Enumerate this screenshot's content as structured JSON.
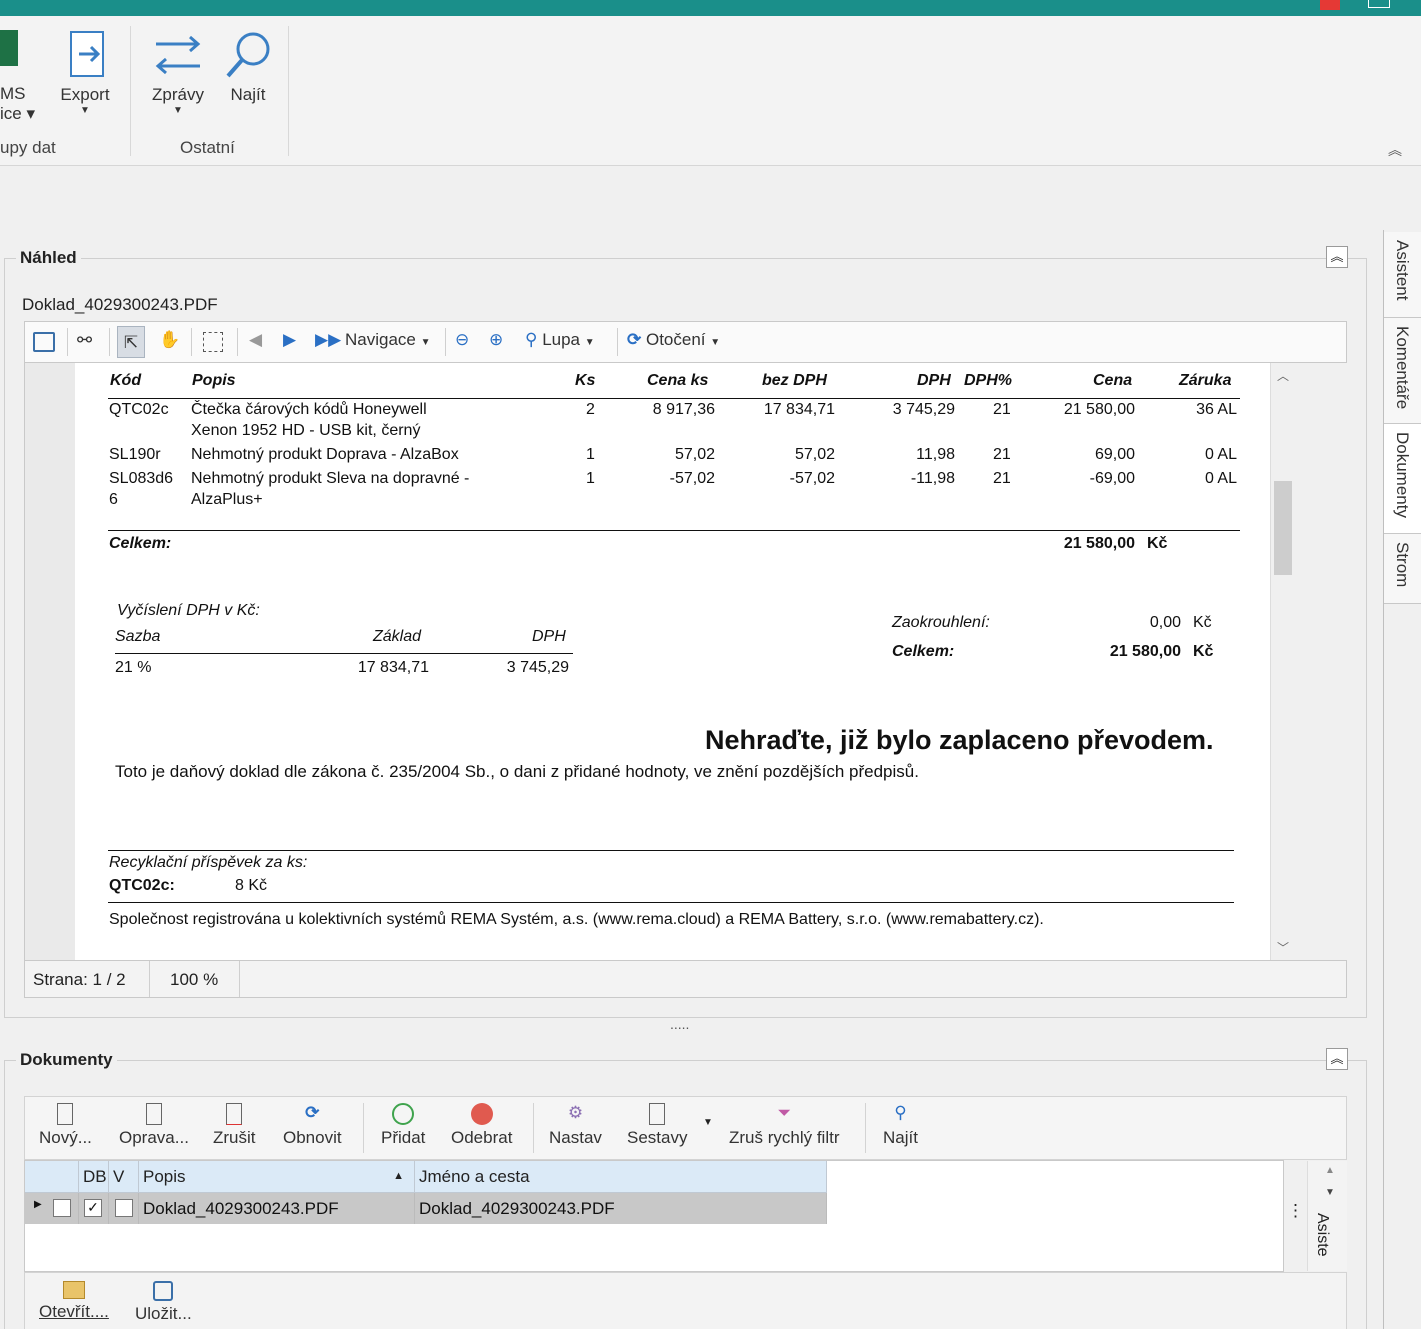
{
  "ribbon": {
    "buttons": {
      "ms_office": "MS\nOffice",
      "export": "Export",
      "zpravy": "Zprávy",
      "najit": "Najít"
    },
    "ms_partial_1": "MS",
    "ms_partial_2": "ice ▾",
    "group_data": "upy dat",
    "group_ostatni": "Ostatní"
  },
  "nahled": {
    "title": "Náhled",
    "filename": "Doklad_4029300243.PDF",
    "toolbar": {
      "navigace": "Navigace",
      "lupa": "Lupa",
      "otoceni": "Otočení"
    },
    "status": {
      "strana": "Strana: 1 / 2",
      "zoom": "100 %"
    }
  },
  "invoice": {
    "headers": [
      "Kód",
      "Popis",
      "Ks",
      "Cena ks",
      "bez DPH",
      "DPH",
      "DPH%",
      "Cena",
      "Záruka"
    ],
    "rows": [
      {
        "kod": "QTC02c",
        "popis1": "Čtečka čárových kódů Honeywell",
        "popis2": "Xenon 1952 HD - USB kit, černý",
        "ks": "2",
        "cena_ks": "8 917,36",
        "bez_dph": "17 834,71",
        "dph": "3 745,29",
        "dph_pct": "21",
        "cena": "21 580,00",
        "zaruka": "36 AL"
      },
      {
        "kod": "SL190r",
        "popis1": "Nehmotný produkt Doprava - AlzaBox",
        "popis2": "",
        "ks": "1",
        "cena_ks": "57,02",
        "bez_dph": "57,02",
        "dph": "11,98",
        "dph_pct": "21",
        "cena": "69,00",
        "zaruka": "0 AL"
      },
      {
        "kod": "SL083d6",
        "kod2": "6",
        "popis1": "Nehmotný produkt Sleva na dopravné -",
        "popis2": "AlzaPlus+",
        "ks": "1",
        "cena_ks": "-57,02",
        "bez_dph": "-57,02",
        "dph": "-11,98",
        "dph_pct": "21",
        "cena": "-69,00",
        "zaruka": "0 AL"
      }
    ],
    "celkem_label": "Celkem:",
    "celkem_value": "21 580,00",
    "currency": "Kč",
    "vat_title": "Vyčíslení DPH v Kč:",
    "vat_headers": [
      "Sazba",
      "Základ",
      "DPH"
    ],
    "vat_row": [
      "21 %",
      "17 834,71",
      "3 745,29"
    ],
    "zaokrouhleni_label": "Zaokrouhlení:",
    "zaokrouhleni_value": "0,00",
    "celkem2_label": "Celkem:",
    "celkem2_value": "21 580,00",
    "paid_note": "Nehraďte, již bylo zaplaceno převodem.",
    "legal_note": "Toto je daňový doklad dle zákona č. 235/2004 Sb., o dani z přidané hodnoty, ve znění pozdějších předpisů.",
    "recycl_label": "Recyklační příspěvek za ks:",
    "recycl_code": "QTC02c:",
    "recycl_value": "8 Kč",
    "company_note": "Společnost registrována u kolektivních systémů REMA Systém, a.s. (www.rema.cloud) a REMA Battery, s.r.o. (www.remabattery.cz)."
  },
  "dokumenty": {
    "title": "Dokumenty",
    "toolbar": [
      "Nový...",
      "Oprava...",
      "Zrušit",
      "Obnovit",
      "Přidat",
      "Odebrat",
      "Nastav",
      "Sestavy",
      "Zruš rychlý filtr",
      "Najít"
    ],
    "columns": {
      "db": "DB",
      "v": "V",
      "popis": "Popis",
      "jmeno": "Jméno a cesta"
    },
    "rows": [
      {
        "popis": "Doklad_4029300243.PDF",
        "jmeno": "Doklad_4029300243.PDF",
        "db": true,
        "v": false
      }
    ],
    "bottom_buttons": [
      "Otevřít....",
      "Uložit..."
    ],
    "side_label": "Asiste"
  },
  "side_tabs": [
    "Asistent",
    "Komentáře",
    "Dokumenty",
    "Strom"
  ],
  "splitter": "....."
}
